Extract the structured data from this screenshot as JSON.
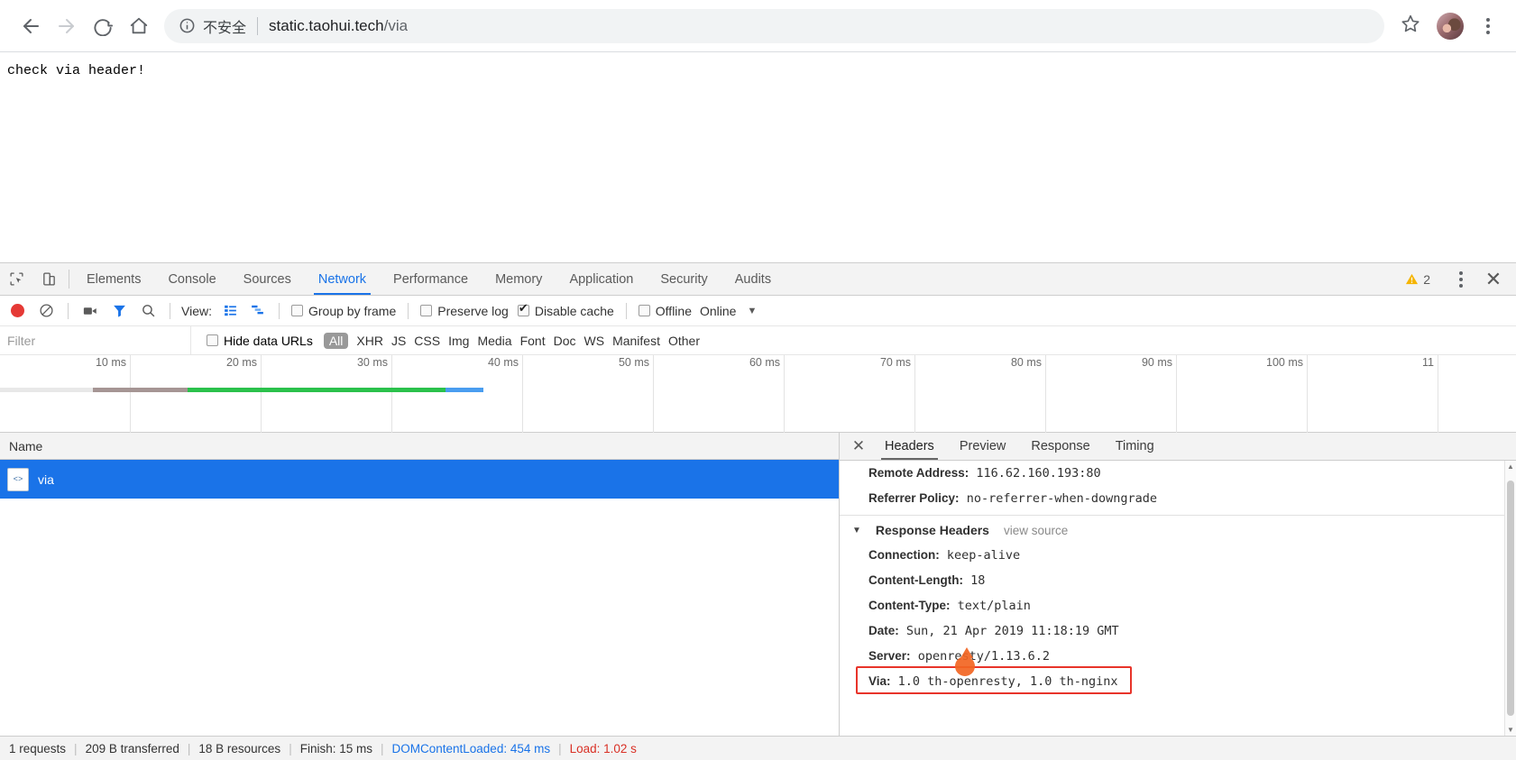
{
  "browser": {
    "back_label": "back-arrow",
    "forward_label": "forward-arrow",
    "reload_label": "reload",
    "home_label": "home",
    "security_label": "不安全",
    "url_host": "static.taohui.tech",
    "url_path": "/via",
    "bookmark_label": "bookmark-star",
    "menu_label": "chrome-menu"
  },
  "page": {
    "body_text": "check via header!"
  },
  "devtools": {
    "tabs": [
      {
        "label": "Elements",
        "active": false
      },
      {
        "label": "Console",
        "active": false
      },
      {
        "label": "Sources",
        "active": false
      },
      {
        "label": "Network",
        "active": true
      },
      {
        "label": "Performance",
        "active": false
      },
      {
        "label": "Memory",
        "active": false
      },
      {
        "label": "Application",
        "active": false
      },
      {
        "label": "Security",
        "active": false
      },
      {
        "label": "Audits",
        "active": false
      }
    ],
    "warning_count": "2",
    "close_label": "✕",
    "toolbar": {
      "record_label": "record",
      "clear_label": "clear",
      "capture_screenshots_label": "camera",
      "filter_label": "filter",
      "search_label": "search",
      "view_label": "View:",
      "group_by_frame": "Group by frame",
      "group_by_frame_checked": false,
      "preserve_log": "Preserve log",
      "preserve_log_checked": false,
      "disable_cache": "Disable cache",
      "disable_cache_checked": true,
      "offline": "Offline",
      "offline_checked": false,
      "online": "Online",
      "more_label": "▼"
    },
    "filter": {
      "placeholder": "Filter",
      "value": "",
      "hide_data_urls": "Hide data URLs",
      "hide_data_urls_checked": false,
      "types": [
        "All",
        "XHR",
        "JS",
        "CSS",
        "Img",
        "Media",
        "Font",
        "Doc",
        "WS",
        "Manifest",
        "Other"
      ],
      "selected_type": "All"
    },
    "overview": {
      "ticks": [
        "10 ms",
        "20 ms",
        "30 ms",
        "40 ms",
        "50 ms",
        "60 ms",
        "70 ms",
        "80 ms",
        "90 ms",
        "100 ms",
        "11"
      ],
      "bar_segments": [
        {
          "name": "queueing",
          "color": "#e8e8e8",
          "left_pct": 0.0,
          "width_pct": 6.1
        },
        {
          "name": "stalled",
          "color": "#a59594",
          "left_pct": 6.1,
          "width_pct": 6.3
        },
        {
          "name": "waiting",
          "color": "#2bc14c",
          "left_pct": 12.4,
          "width_pct": 3.0
        },
        {
          "name": "receiving",
          "color": "#2bc14c",
          "left_pct": 15.4,
          "width_pct": 14.0
        },
        {
          "name": "done",
          "color": "#4a9df0",
          "left_pct": 29.4,
          "width_pct": 2.5
        }
      ]
    },
    "requests": {
      "column_name": "Name",
      "rows": [
        {
          "name": "via",
          "icon": "document-icon",
          "selected": true
        }
      ]
    },
    "detail": {
      "close_label": "✕",
      "tabs": [
        {
          "label": "Headers",
          "active": true
        },
        {
          "label": "Preview",
          "active": false
        },
        {
          "label": "Response",
          "active": false
        },
        {
          "label": "Timing",
          "active": false
        }
      ],
      "general_rows": [
        {
          "key": "Remote Address:",
          "value": "116.62.160.193:80"
        },
        {
          "key": "Referrer Policy:",
          "value": "no-referrer-when-downgrade"
        }
      ],
      "response_section": {
        "triangle": "▼",
        "title": "Response Headers",
        "view_source": "view source"
      },
      "response_headers": [
        {
          "key": "Connection:",
          "value": "keep-alive",
          "highlighted": false
        },
        {
          "key": "Content-Length:",
          "value": "18",
          "highlighted": false
        },
        {
          "key": "Content-Type:",
          "value": "text/plain",
          "highlighted": false
        },
        {
          "key": "Date:",
          "value": "Sun, 21 Apr 2019 11:18:19 GMT",
          "highlighted": false
        },
        {
          "key": "Server:",
          "value": "openresty/1.13.6.2",
          "highlighted": false
        },
        {
          "key": "Via:",
          "value": "1.0 th-openresty, 1.0 th-nginx",
          "highlighted": true
        }
      ],
      "highlight_color": "#e8342a"
    },
    "status": {
      "requests": "1 requests",
      "transferred": "209 B transferred",
      "resources": "18 B resources",
      "finish": "Finish: 15 ms",
      "dom_content_loaded": "DOMContentLoaded: 454 ms",
      "load": "Load: 1.02 s",
      "separator": "|"
    }
  }
}
